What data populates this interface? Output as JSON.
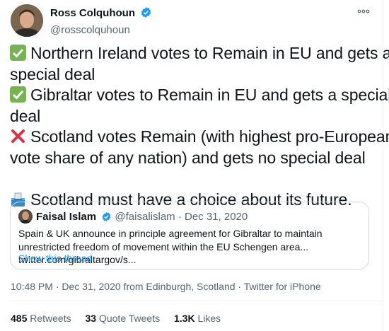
{
  "author": {
    "display_name": "Ross Colquhoun",
    "handle": "@rosscolquhoun"
  },
  "tweet": {
    "lines": [
      {
        "icon": "check-mark-icon",
        "text": "Northern Ireland votes to Remain in EU and gets a"
      },
      {
        "icon": "",
        "text": "special deal"
      },
      {
        "icon": "check-mark-icon",
        "text": "Gibraltar votes to Remain in EU and gets a special"
      },
      {
        "icon": "",
        "text": "deal"
      },
      {
        "icon": "cross-mark-icon",
        "text": "Scotland votes Remain (with highest pro-European"
      },
      {
        "icon": "",
        "text": "vote share of any nation) and gets no special deal"
      },
      {
        "icon": "ballot-box-icon",
        "text": "Scotland must have a choice about its future."
      }
    ]
  },
  "quote": {
    "display_name": "Faisal Islam",
    "handle": "@faisalislam",
    "separator": "·",
    "date": "Dec 31, 2020",
    "text": "Spain & UK announce in principle agreement for Gibraltar to maintain unrestricted freedom of movement within the EU Schengen area... twitter.com/gibraltargov/s...",
    "show_thread": "Show this thread"
  },
  "meta": "10:48 PM · Dec 31, 2020 from Edinburgh, Scotland · Twitter for iPhone",
  "stats": {
    "retweets": {
      "count": "485",
      "label": "Retweets"
    },
    "quotes": {
      "count": "33",
      "label": "Quote Tweets"
    },
    "likes": {
      "count": "1.3K",
      "label": "Likes"
    }
  },
  "colors": {
    "link": "#1d9bf0",
    "secondary_text": "#536471",
    "check_green": "#77b255",
    "cross_red": "#dd2e44"
  }
}
